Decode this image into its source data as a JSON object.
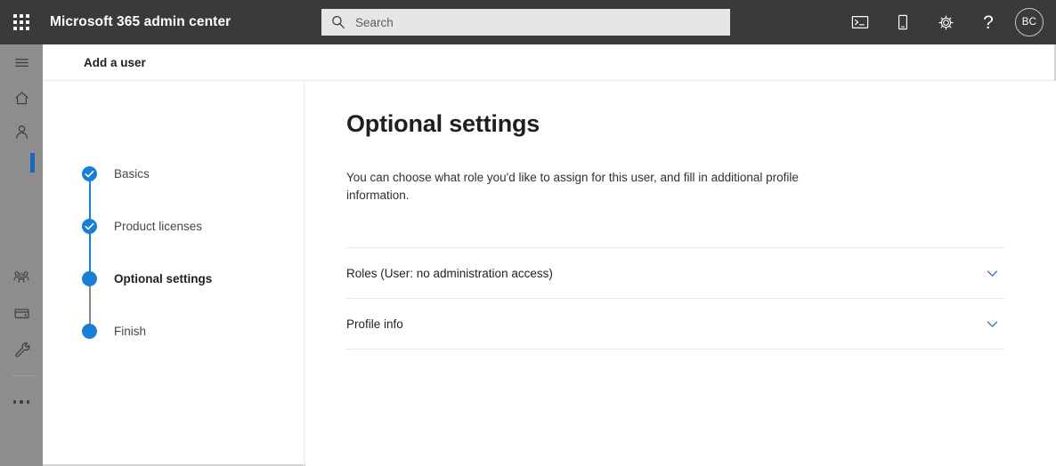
{
  "suite": {
    "waffle_label": "app-launcher",
    "title": "Microsoft 365 admin center",
    "search": {
      "placeholder": "Search",
      "value": ""
    },
    "actions": [
      {
        "name": "console-icon",
        "label": "Open console"
      },
      {
        "name": "mobile-device-icon",
        "label": "Mobile device"
      },
      {
        "name": "gear-icon",
        "label": "Settings"
      },
      {
        "name": "help-icon",
        "label": "?"
      }
    ],
    "avatar": {
      "initials": "BC"
    }
  },
  "rail": {
    "items": [
      {
        "name": "hamburger-icon",
        "label": "Show navigation"
      },
      {
        "name": "home-icon",
        "label": "Home"
      },
      {
        "name": "user-icon",
        "label": "Users"
      },
      {
        "name": "teams-groups-icon",
        "label": "Teams & groups"
      },
      {
        "name": "billing-icon",
        "label": "Billing"
      },
      {
        "name": "wrench-icon",
        "label": "Setup"
      },
      {
        "name": "ellipsis-icon",
        "label": "Show all"
      }
    ]
  },
  "panel": {
    "header_title": "Add a user"
  },
  "wizard": {
    "steps": [
      {
        "label": "Basics",
        "state": "completed"
      },
      {
        "label": "Product licenses",
        "state": "completed"
      },
      {
        "label": "Optional settings",
        "state": "current"
      },
      {
        "label": "Finish",
        "state": "upcoming"
      }
    ]
  },
  "main": {
    "title": "Optional settings",
    "description": "You can choose what role you'd like to assign for this user, and fill in additional profile information.",
    "sections": [
      {
        "label": "Roles (User: no administration access)",
        "icon": "chevron-down-icon",
        "expanded": false
      },
      {
        "label": "Profile info",
        "icon": "chevron-down-icon",
        "expanded": false
      }
    ]
  },
  "colors": {
    "accent": "#1a7fd4",
    "suite_bar": "#3b3a39",
    "rail": "#8e8d8c",
    "chevron": "#4a7fc1"
  }
}
